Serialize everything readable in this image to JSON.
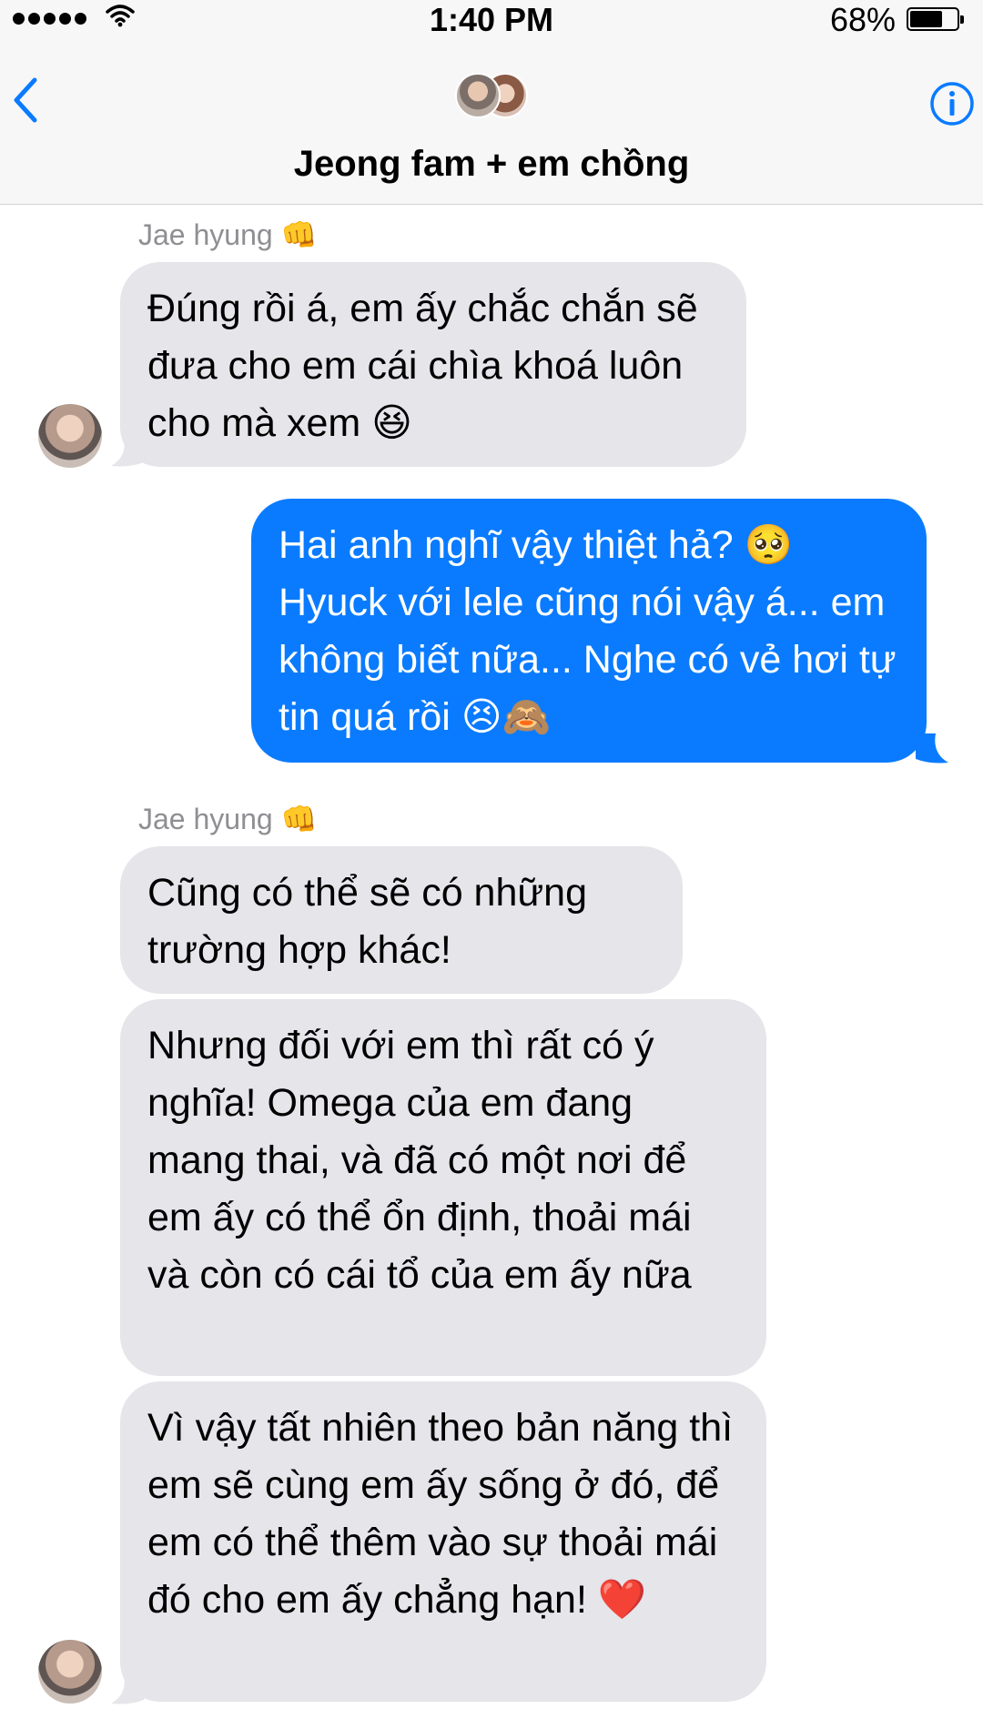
{
  "status_bar": {
    "time": "1:40 PM",
    "battery": "68%",
    "battery_level": 0.68
  },
  "header": {
    "title": "Jeong fam + em chồng",
    "back_icon": "chevron-left-icon",
    "info_icon": "info-icon"
  },
  "messages": [
    {
      "sender": "Jae hyung 👊",
      "text": "Đúng rồi á, em ấy chắc chắn sẽ đưa cho em cái chìa khoá luôn cho mà xem 😆"
    },
    {
      "text": "Hai anh nghĩ vậy thiệt hả? 🥺 Hyuck với lele cũng nói vậy á... em không biết nữa... Nghe có vẻ hơi tự tin quá rồi 😣🙈"
    },
    {
      "sender": "Jae hyung 👊",
      "text": "Cũng có thể sẽ có những trường hợp khác!"
    },
    {
      "text": "Nhưng đối với em thì rất có ý nghĩa! Omega của em đang mang thai, và đã có một nơi để em ấy có thể ổn định, thoải mái và còn có cái tổ của em ấy nữa"
    },
    {
      "text": "Vì vậy tất nhiên theo bản năng thì em sẽ cùng em ấy sống ở đó, để em có thể thêm vào sự thoải mái đó cho em ấy chẳng hạn! ❤️"
    }
  ],
  "colors": {
    "incoming": "#e5e5ea",
    "outgoing": "#0a7bff",
    "accent": "#0a7bff"
  }
}
